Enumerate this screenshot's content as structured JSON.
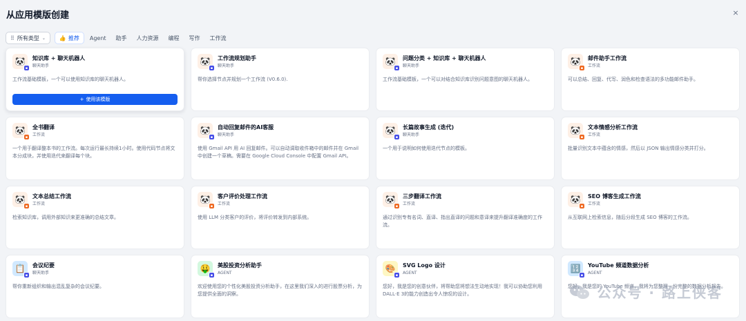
{
  "title": "从应用模版创建",
  "close_icon": "×",
  "filter": {
    "type_label": "所有类型",
    "tabs": [
      {
        "label": "推荐",
        "active": true
      },
      {
        "label": "Agent"
      },
      {
        "label": "助手"
      },
      {
        "label": "人力资源"
      },
      {
        "label": "编程"
      },
      {
        "label": "写作"
      },
      {
        "label": "工作流"
      }
    ]
  },
  "use_button": "使用该模版",
  "cards": [
    {
      "name": "知识库 + 聊天机器人",
      "type": "聊天助手",
      "desc": "工作流基础模板，一个可以使用知识库的聊天机器人。",
      "icon": "🐼",
      "bg": "#fef0e6",
      "sub": "#444ce7",
      "hover": true
    },
    {
      "name": "工作流规划助手",
      "type": "聊天助手",
      "desc": "帮你选择节点并规划一个工作流 (V0.6.0).",
      "icon": "🐼",
      "bg": "#fef0e6",
      "sub": "#444ce7"
    },
    {
      "name": "问题分类 + 知识库 + 聊天机器人",
      "type": "聊天助手",
      "desc": "工作流基础模板，一个可以对结合知识库识别问题意图的聊天机器人。",
      "icon": "🐼",
      "bg": "#fef0e6",
      "sub": "#444ce7"
    },
    {
      "name": "邮件助手工作流",
      "type": "工作流",
      "desc": "可以总结、回复、代写、润色和检查语法的多功能邮件助手。",
      "icon": "🐼",
      "bg": "#fef0e6",
      "sub": "#ef6820"
    },
    {
      "name": "全书翻译",
      "type": "工作流",
      "desc": "一个用于翻译整本书的工作流。每次运行最长持续1小时。使用代码节点将文本分成块，并使用迭代来翻译每个块。",
      "icon": "🐼",
      "bg": "#fef0e6",
      "sub": "#ef6820"
    },
    {
      "name": "自动回复邮件的AI客服",
      "type": "聊天助手",
      "desc": "使用 Gmail API 用 AI 回复邮件。可以自动调取收件箱中的邮件并在 Gmail 中创建一个草稿。需要在 Google Cloud Console 中配置 Gmail API。",
      "icon": "🐼",
      "bg": "#fef0e6",
      "sub": "#444ce7"
    },
    {
      "name": "长篇故事生成 (迭代)",
      "type": "聊天助手",
      "desc": "一个用于说明如何使用迭代节点的模板。",
      "icon": "🐼",
      "bg": "#fef0e6",
      "sub": "#444ce7"
    },
    {
      "name": "文本情感分析工作流",
      "type": "工作流",
      "desc": "批量识别文本中蕴含的情感，然后以 JSON 输出情感分类并打分。",
      "icon": "🐼",
      "bg": "#fef0e6",
      "sub": "#ef6820"
    },
    {
      "name": "文本总结工作流",
      "type": "工作流",
      "desc": "检索知识库，调用外部知识来更准确的总结文章。",
      "icon": "🐼",
      "bg": "#fef0e6",
      "sub": "#ef6820"
    },
    {
      "name": "客户评价处理工作流",
      "type": "工作流",
      "desc": "使用 LLM 分类客户的评价，将评价转发到内部系统。",
      "icon": "🐼",
      "bg": "#fef0e6",
      "sub": "#ef6820"
    },
    {
      "name": "三步翻译工作流",
      "type": "工作流",
      "desc": "通过识别专有名词、直译、指出直译的问题和意译来提升翻译准确度的工作流。",
      "icon": "🐼",
      "bg": "#fef0e6",
      "sub": "#ef6820"
    },
    {
      "name": "SEO 博客生成工作流",
      "type": "工作流",
      "desc": "从互联网上检索信息，随后分段生成 SEO 博客的工作流。",
      "icon": "🐼",
      "bg": "#fef0e6",
      "sub": "#ef6820"
    },
    {
      "name": "会议纪要",
      "type": "聊天助手",
      "desc": "帮你重新组织和输出混乱复杂的会议纪要。",
      "icon": "📋",
      "bg": "#d1e9ff",
      "sub": "#444ce7"
    },
    {
      "name": "美股投资分析助手",
      "type": "AGENT",
      "desc": "欢迎使用您的个性化美股投资分析助手，在这里我们深入的进行股票分析，为您提供全面的洞察。",
      "icon": "🤑",
      "bg": "#d3f8df",
      "sub": "#444ce7"
    },
    {
      "name": "SVG Logo 设计",
      "type": "AGENT",
      "desc": "您好，我是您的创意伙伴，将帮助您将想法生动地实现！我可以协助您利用 DALL·E 3的能力创造出令人惊叹的设计。",
      "icon": "🎨",
      "bg": "#fef7c3",
      "sub": "#444ce7"
    },
    {
      "name": "YouTube 频道数据分析",
      "type": "AGENT",
      "desc": "您好，我是您的 YouTube 频道，我将为您整理一份完整的数据分析报告。",
      "icon": "🔢",
      "bg": "#d1e9ff",
      "sub": "#444ce7"
    }
  ],
  "watermark": "公众号 · 路上侠客"
}
